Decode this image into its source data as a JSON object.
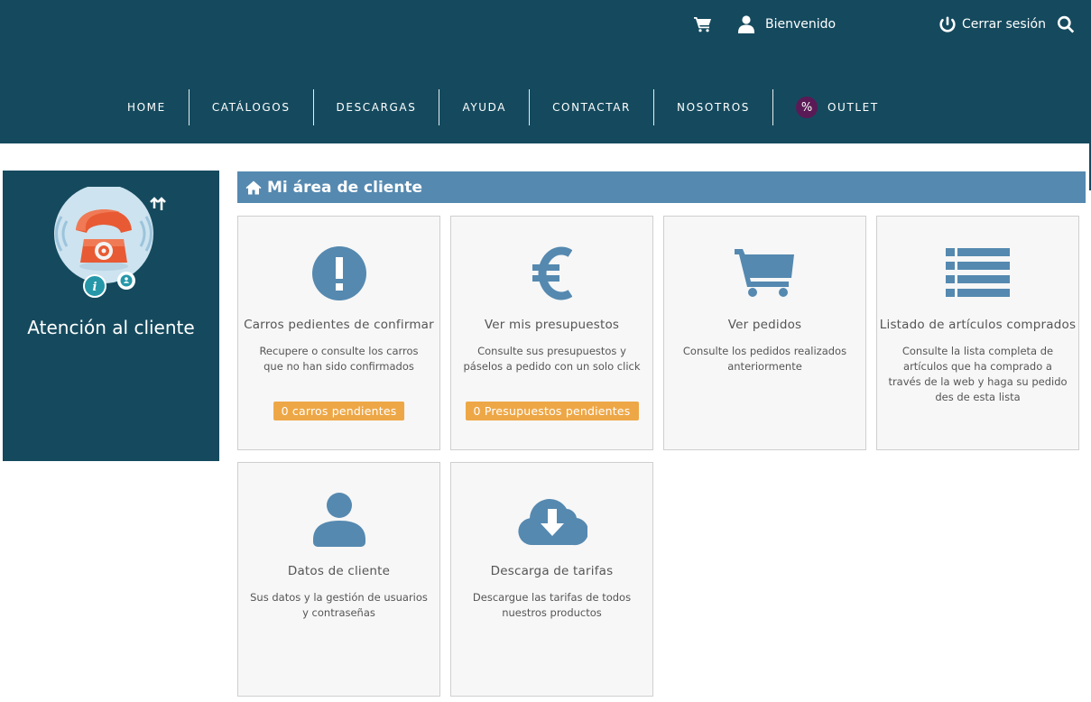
{
  "topbar": {
    "welcome_label": "Bienvenido",
    "logout_label": "Cerrar sesión"
  },
  "nav": {
    "items": [
      "HOME",
      "CATÁLOGOS",
      "DESCARGAS",
      "AYUDA",
      "CONTACTAR",
      "NOSOTROS"
    ],
    "outlet_badge": "%",
    "outlet_label": "OUTLET"
  },
  "sidebar": {
    "title": "Atención al cliente"
  },
  "main": {
    "title": "Mi área de cliente",
    "cards": [
      {
        "title": "Carros pedientes de confirmar",
        "desc": "Recupere o consulte los carros que no han sido confirmados",
        "button": "0 carros pendientes",
        "icon": "exclamation-circle-icon"
      },
      {
        "title": "Ver mis presupuestos",
        "desc": "Consulte sus presupuestos y páselos a pedido con un solo click",
        "button": "0 Presupuestos pendientes",
        "icon": "euro-icon"
      },
      {
        "title": "Ver pedidos",
        "desc": "Consulte los pedidos realizados anteriormente",
        "icon": "shopping-cart-icon"
      },
      {
        "title": "Listado de artículos comprados",
        "desc": "Consulte la lista completa de artículos que ha comprado a través de la web y haga su pedido des de esta lista",
        "icon": "list-icon"
      },
      {
        "title": "Datos de cliente",
        "desc": "Sus datos y la gestión de usuarios y contraseñas",
        "icon": "user-icon"
      },
      {
        "title": "Descarga de tarifas",
        "desc": "Descargue las tarifas de todos nuestros productos",
        "icon": "cloud-download-icon"
      }
    ]
  },
  "colors": {
    "header_bg": "#154a5e",
    "accent_blue": "#5589b0",
    "button_orange": "#eea746",
    "outlet_purple": "#5a1a55",
    "phone_red": "#e85a33"
  }
}
